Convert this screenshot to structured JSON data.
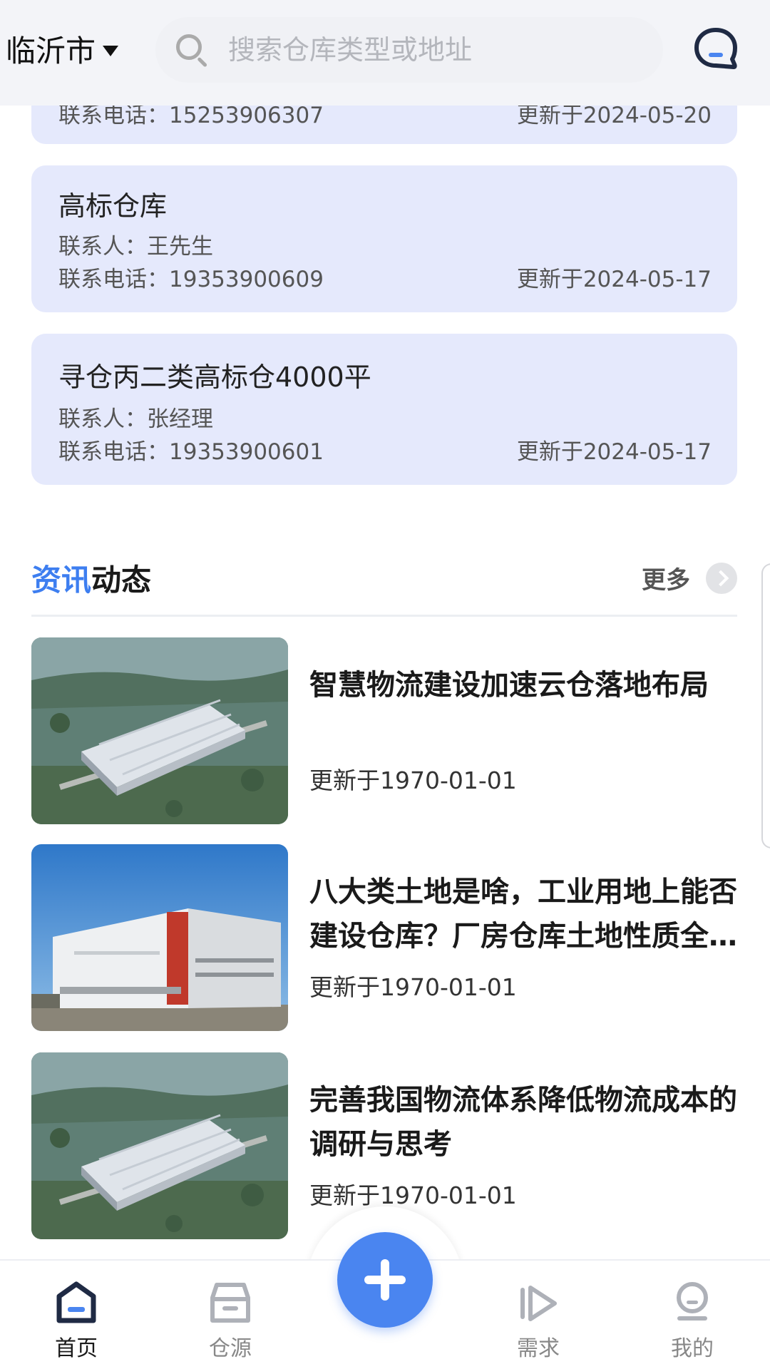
{
  "header": {
    "city": "临沂市",
    "search_placeholder": "搜索仓库类型或地址"
  },
  "warehouses": [
    {
      "phone": "联系电话：15253906307",
      "updated": "更新于2024-05-20"
    },
    {
      "title": "高标仓库",
      "contact": "联系人：王先生",
      "phone": "联系电话：19353900609",
      "updated": "更新于2024-05-17"
    },
    {
      "title": "寻仓丙二类高标仓4000平",
      "contact": "联系人：张经理",
      "phone": "联系电话：19353900601",
      "updated": "更新于2024-05-17"
    }
  ],
  "news": {
    "title_highlight": "资讯",
    "title_rest": "动态",
    "more_label": "更多",
    "items": [
      {
        "headline": "智慧物流建设加速云仓落地布局",
        "date": "更新于1970-01-01",
        "image": "aerial-warehouse-render"
      },
      {
        "headline": "八大类土地是啥，工业用地上能否建设仓库？厂房仓库土地性质全解析",
        "date": "更新于1970-01-01",
        "image": "warehouse-building-photo"
      },
      {
        "headline": "完善我国物流体系降低物流成本的调研与思考",
        "date": "更新于1970-01-01",
        "image": "aerial-warehouse-render"
      }
    ]
  },
  "bottom_nav": [
    {
      "label": "首页",
      "icon": "home-icon",
      "active": true
    },
    {
      "label": "仓源",
      "icon": "warehouse-icon",
      "active": false
    },
    {
      "label": "需求",
      "icon": "demand-icon",
      "active": false
    },
    {
      "label": "我的",
      "icon": "profile-icon",
      "active": false
    }
  ],
  "colors": {
    "accent": "#4a85f0",
    "news_highlight": "#3d7ef0",
    "card_bg": "#e5e9fc",
    "header_bg": "#f3f4f8"
  }
}
